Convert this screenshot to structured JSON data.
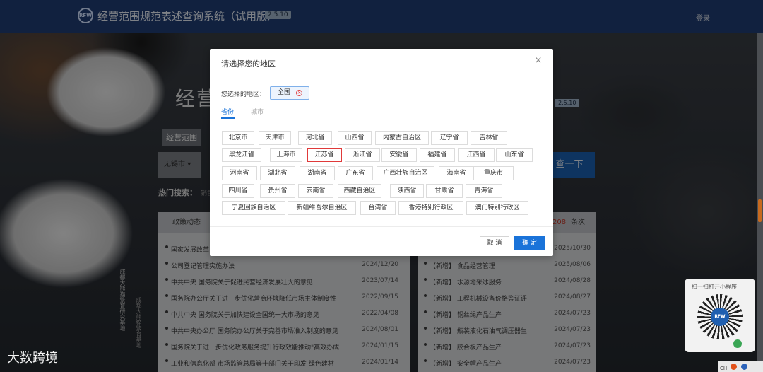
{
  "header": {
    "logo_text": "RFW",
    "title": "经营范围规范表述查询系统（试用版）",
    "version": "2.5.10",
    "login": "登录"
  },
  "hero": {
    "title_partial": "经营",
    "version": "2.5.10",
    "scope_tab": "经营范围",
    "region_value": "无锡市",
    "search_button": "查一下",
    "hot_label": "热门搜索：",
    "hot_partial": "销售"
  },
  "policy": {
    "header": "政策动态",
    "rows": [
      {
        "title": "国家发展改革",
        "date": ""
      },
      {
        "title": "公司登记管理实施办法",
        "date": "2024/12/20"
      },
      {
        "title": "中共中央 国务院关于促进民营经济发展壮大的意见",
        "date": "2023/07/14"
      },
      {
        "title": "国务院办公厅关于进一步优化营商环境降低市场主体制度性",
        "date": "2022/09/15"
      },
      {
        "title": "中共中央 国务院关于加快建设全国统一大市场的意见",
        "date": "2022/04/08"
      },
      {
        "title": "中共中央办公厅 国务院办公厅关于完善市场准入制度的意见",
        "date": "2024/08/01"
      },
      {
        "title": "国务院关于进一步优化政务服务提升行政效能推动\"高效办成",
        "date": "2024/01/15"
      },
      {
        "title": "工业和信息化部 市场监管总局等十部门关于印发 绿色建材",
        "date": "2024/01/14"
      }
    ]
  },
  "news": {
    "count_num": "208",
    "count_unit": "条次",
    "rows": [
      {
        "title": "",
        "date": "2025/10/30"
      },
      {
        "title": "【新增】 食品经营管理",
        "date": "2025/08/06"
      },
      {
        "title": "【新增】 水源地采冰服务",
        "date": "2024/08/28"
      },
      {
        "title": "【新增】 工程机械设备价格鉴证评",
        "date": "2024/08/27"
      },
      {
        "title": "【新增】 铜丝绳产品生产",
        "date": "2024/07/23"
      },
      {
        "title": "【新增】 瓶装液化石油气调压器生",
        "date": "2024/07/23"
      },
      {
        "title": "【新增】 胶合板产品生产",
        "date": "2024/07/23"
      },
      {
        "title": "【新增】 安全帽产品生产",
        "date": "2024/07/23"
      }
    ]
  },
  "side_text": "成都大熊猫繁育研究基地",
  "side_text2": "成都大熊猫繁育基地",
  "mini_program": {
    "label": "扫一扫打开小程序",
    "center": "RFW"
  },
  "watermark": "大数跨境",
  "tray": {
    "ch": "CH"
  },
  "modal": {
    "title": "请选择您的地区",
    "close": "×",
    "selected_label": "您选择的地区：",
    "selected_value": "全国",
    "chip_remove": "×",
    "tab_province": "省份",
    "tab_city": "城市",
    "provinces": [
      "北京市",
      "天津市",
      "河北省",
      "山西省",
      "内蒙古自治区",
      "辽宁省",
      "吉林省",
      "黑龙江省",
      "上海市",
      "江苏省",
      "浙江省",
      "安徽省",
      "福建省",
      "江西省",
      "山东省",
      "河南省",
      "湖北省",
      "湖南省",
      "广东省",
      "广西壮族自治区",
      "海南省",
      "重庆市",
      "四川省",
      "贵州省",
      "云南省",
      "西藏自治区",
      "陕西省",
      "甘肃省",
      "青海省",
      "宁夏回族自治区",
      "新疆维吾尔自治区",
      "台湾省",
      "香港特别行政区",
      "澳门特别行政区"
    ],
    "selected_province": "江苏省",
    "cancel": "取 消",
    "ok": "确 定"
  }
}
